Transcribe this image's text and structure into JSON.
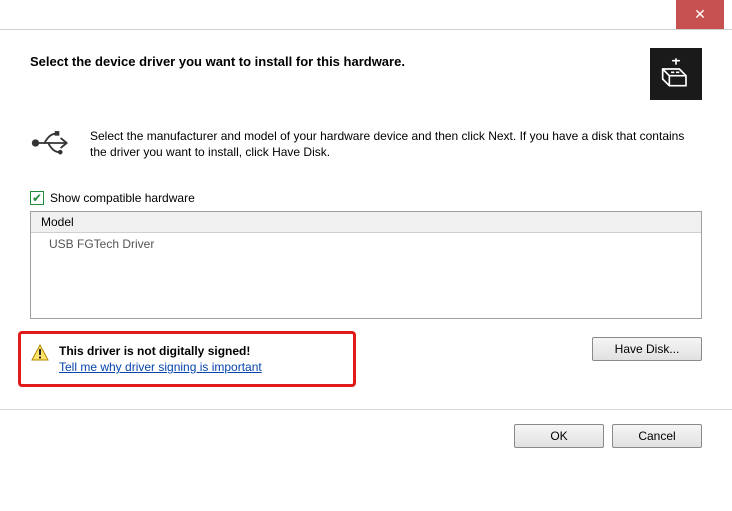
{
  "titlebar": {
    "close": "✕"
  },
  "header": {
    "title": "Select the device driver you want to install for this hardware."
  },
  "instructions": "Select the manufacturer and model of your hardware device and then click Next. If you have a disk that contains the driver you want to install, click Have Disk.",
  "checkbox": {
    "label": "Show compatible hardware",
    "checked": true
  },
  "list": {
    "header": "Model",
    "items": [
      "USB FGTech Driver"
    ]
  },
  "warning": {
    "title": "This driver is not digitally signed!",
    "link": "Tell me why driver signing is important"
  },
  "buttons": {
    "have_disk": "Have Disk...",
    "ok": "OK",
    "cancel": "Cancel"
  }
}
